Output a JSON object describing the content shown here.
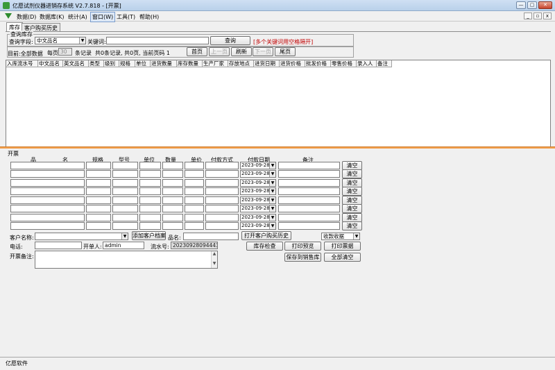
{
  "window": {
    "title": "亿愿试剂仪器进销存系统 V2.7.818 - [开票]",
    "min_glyph": "—",
    "max_glyph": "▢",
    "close_glyph": "✕"
  },
  "menu": {
    "items": [
      "数据(D)",
      "数据库(K)",
      "统计(A)",
      "窗口(W)",
      "工具(T)",
      "帮助(H)"
    ],
    "active_index": 3,
    "mdi_min": "_",
    "mdi_restore": "▫",
    "mdi_close": "x"
  },
  "tabs": [
    {
      "label": "库存",
      "active": true
    },
    {
      "label": "客户购买历史",
      "active": false
    }
  ],
  "stock_query": {
    "group_title": "查询库存",
    "field_label": "查询字段:",
    "field_value": "中文品名",
    "keyword_label": "关键词:",
    "keyword_value": "",
    "query_button": "查询",
    "hint": "[多个关键词用空格隔开]",
    "current_label": "目前:全部数据",
    "per_page_label": "每页",
    "per_page_value": "30",
    "records_label": "条记录",
    "summary": "共0条记录, 共0页, 当前页码 1",
    "first_page": "首页",
    "prev_page": "上一页",
    "refresh": "刷新",
    "next_page": "下一页",
    "last_page": "尾页"
  },
  "grid": {
    "columns": [
      "入库流水号",
      "中文品名",
      "英文品名",
      "类型",
      "级别",
      "规格",
      "单位",
      "进货数量",
      "库存数量",
      "生产厂家",
      "存放地点",
      "进货日期",
      "进货价格",
      "批发价格",
      "零售价格",
      "录入人",
      "备注"
    ]
  },
  "invoice": {
    "section_title": "开票",
    "headers": [
      "品",
      "名",
      "规格",
      "型号",
      "单位",
      "数量",
      "单价",
      "付款方式",
      "付款日期",
      "备注"
    ],
    "rows": [
      {
        "date": "2023-09-28",
        "clear": "清空"
      },
      {
        "date": "2023-09-28",
        "clear": "清空"
      },
      {
        "date": "2023-09-28",
        "clear": "清空"
      },
      {
        "date": "2023-09-28",
        "clear": "清空"
      },
      {
        "date": "2023-09-28",
        "clear": "清空"
      },
      {
        "date": "2023-09-28",
        "clear": "清空"
      },
      {
        "date": "2023-09-28",
        "clear": "清空"
      },
      {
        "date": "2023-09-28",
        "clear": "清空"
      }
    ],
    "customer_label": "客户名称:",
    "customer_value": "",
    "add_customer_button": "添加客户档案",
    "product_label": "品名:",
    "product_value": "",
    "open_history_button": "打开客户购买历史",
    "receipt_value": "收款收据",
    "phone_label": "电话:",
    "phone_value": "",
    "issuer_label": "开单人:",
    "issuer_value": "admin",
    "serial_label": "流水号:",
    "serial_value": "20230928094443",
    "check_stock_button": "库存检查",
    "print_preview_button": "打印预览",
    "print_receipt_button": "打印票据",
    "remark_label": "开票备注:",
    "save_sale_button": "保存到销售库",
    "clear_all_button": "全部清空"
  },
  "status": {
    "text": "亿愿软件"
  }
}
